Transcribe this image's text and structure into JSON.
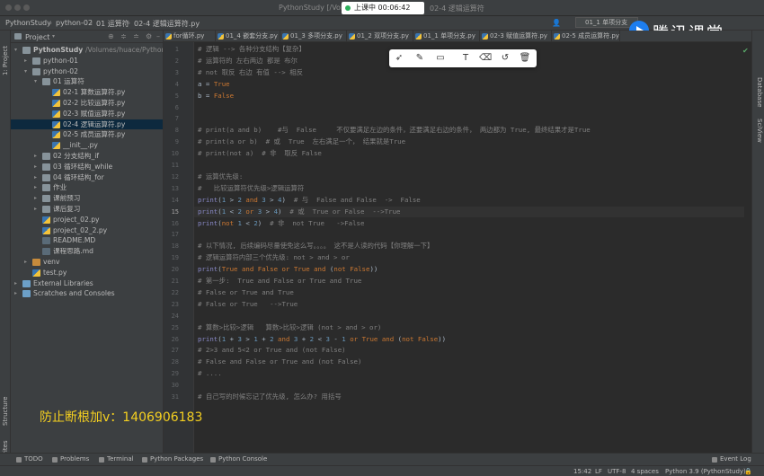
{
  "window": {
    "title_left": "PythonStudy [/Volu",
    "title_right": "02-4 逻辑运算符"
  },
  "recording": {
    "label": "上课中 00:06:42"
  },
  "breadcrumb": [
    "PythonStudy",
    "python-02",
    "01 运算符",
    "02-4 逻辑运算符.py"
  ],
  "run_config": "01_1 单项分支",
  "logo_text": "腾讯课堂",
  "project_panel": {
    "title": "Project",
    "tree": [
      {
        "label": "PythonStudy",
        "path": "/Volumes/huace/PythonS",
        "indent": 0,
        "icon": "folder",
        "arrow": "▾",
        "bold": true
      },
      {
        "label": "python-01",
        "indent": 1,
        "icon": "folder",
        "arrow": "▸"
      },
      {
        "label": "python-02",
        "indent": 1,
        "icon": "folder",
        "arrow": "▾"
      },
      {
        "label": "01 运算符",
        "indent": 2,
        "icon": "folder",
        "arrow": "▾"
      },
      {
        "label": "02-1 算数运算符.py",
        "indent": 3,
        "icon": "py"
      },
      {
        "label": "02-2 比较运算符.py",
        "indent": 3,
        "icon": "py"
      },
      {
        "label": "02-3 赋值运算符.py",
        "indent": 3,
        "icon": "py"
      },
      {
        "label": "02-4 逻辑运算符.py",
        "indent": 3,
        "icon": "py",
        "selected": true
      },
      {
        "label": "02-5 成员运算符.py",
        "indent": 3,
        "icon": "py"
      },
      {
        "label": "__init__.py",
        "indent": 3,
        "icon": "py"
      },
      {
        "label": "02 分支结构_if",
        "indent": 2,
        "icon": "folder",
        "arrow": "▸"
      },
      {
        "label": "03 循环结构_while",
        "indent": 2,
        "icon": "folder",
        "arrow": "▸"
      },
      {
        "label": "04 循环结构_for",
        "indent": 2,
        "icon": "folder",
        "arrow": "▸"
      },
      {
        "label": "作业",
        "indent": 2,
        "icon": "folder",
        "arrow": "▸"
      },
      {
        "label": "课前预习",
        "indent": 2,
        "icon": "folder",
        "arrow": "▸"
      },
      {
        "label": "课后复习",
        "indent": 2,
        "icon": "folder",
        "arrow": "▸"
      },
      {
        "label": "project_02.py",
        "indent": 2,
        "icon": "py"
      },
      {
        "label": "project_02_2.py",
        "indent": 2,
        "icon": "py"
      },
      {
        "label": "README.MD",
        "indent": 2,
        "icon": "md"
      },
      {
        "label": "课程思路.md",
        "indent": 2,
        "icon": "md"
      },
      {
        "label": "venv",
        "indent": 1,
        "icon": "folder-orange",
        "arrow": "▸"
      },
      {
        "label": "test.py",
        "indent": 1,
        "icon": "py"
      },
      {
        "label": "External Libraries",
        "indent": 0,
        "icon": "folder-blue",
        "arrow": "▸"
      },
      {
        "label": "Scratches and Consoles",
        "indent": 0,
        "icon": "folder-blue",
        "arrow": "▸"
      }
    ]
  },
  "editor_tabs": [
    {
      "label": "for循环.py"
    },
    {
      "label": "01_4 嵌套分支.py"
    },
    {
      "label": "01_3 多项分支.py"
    },
    {
      "label": "01_2 双项分支.py"
    },
    {
      "label": "01_1 单项分支.py"
    },
    {
      "label": "02-3 赋值运算符.py"
    },
    {
      "label": "02-5 成员运算符.py"
    }
  ],
  "editor": {
    "current_line": 15,
    "lines": [
      [
        [
          "c-com",
          "# 逻辑 --> 各种分支结构【复杂】"
        ]
      ],
      [
        [
          "c-com",
          "# 运算符的 左右两边 都是 布尔"
        ]
      ],
      [
        [
          "c-com",
          "# not 取反 右边 有值 --> 相反"
        ]
      ],
      [
        [
          "c-def",
          "a = "
        ],
        [
          "c-kw",
          "True"
        ]
      ],
      [
        [
          "c-def",
          "b = "
        ],
        [
          "c-kw",
          "False"
        ]
      ],
      [],
      [],
      [
        [
          "c-com",
          "# print(a and b)    #与  False     不仅要满足左边的条件，还要满足右边的条件， 两边都为 True, 最终结果才是True"
        ]
      ],
      [
        [
          "c-com",
          "# print(a or b)  # 或  True  左右满足一个， 结果就是True"
        ]
      ],
      [
        [
          "c-com",
          "# print(not a)  # 非  取反 False"
        ]
      ],
      [],
      [
        [
          "c-com",
          "# 运算优先级:"
        ]
      ],
      [
        [
          "c-com",
          "#   比较运算符优先级>逻辑运算符"
        ]
      ],
      [
        [
          "c-bi",
          "print"
        ],
        [
          "c-def",
          "("
        ],
        [
          "c-num",
          "1"
        ],
        [
          "c-def",
          " > "
        ],
        [
          "c-num",
          "2"
        ],
        [
          "c-def",
          " "
        ],
        [
          "c-kw",
          "and"
        ],
        [
          "c-def",
          " "
        ],
        [
          "c-num",
          "3"
        ],
        [
          "c-def",
          " > "
        ],
        [
          "c-num",
          "4"
        ],
        [
          "c-def",
          ")  "
        ],
        [
          "c-com",
          "# 与  False and False  ->  False"
        ]
      ],
      [
        [
          "c-bi",
          "print"
        ],
        [
          "c-def",
          "("
        ],
        [
          "c-num",
          "1"
        ],
        [
          "c-def",
          " < "
        ],
        [
          "c-num",
          "2"
        ],
        [
          "c-def",
          " "
        ],
        [
          "c-kw",
          "or"
        ],
        [
          "c-def",
          " "
        ],
        [
          "c-num",
          "3"
        ],
        [
          "c-def",
          " > "
        ],
        [
          "c-num",
          "4"
        ],
        [
          "c-def",
          ")  "
        ],
        [
          "c-com",
          "# 或  True or False  -->True"
        ]
      ],
      [
        [
          "c-bi",
          "print"
        ],
        [
          "c-def",
          "("
        ],
        [
          "c-kw",
          "not"
        ],
        [
          "c-def",
          " "
        ],
        [
          "c-num",
          "1"
        ],
        [
          "c-def",
          " < "
        ],
        [
          "c-num",
          "2"
        ],
        [
          "c-def",
          ")  "
        ],
        [
          "c-com",
          "# 非  not True   ->False"
        ]
      ],
      [],
      [
        [
          "c-com",
          "# 以下情况, 后续编码尽量使免这么写。。。。 这不是人读的代码【你理解一下】"
        ]
      ],
      [
        [
          "c-com",
          "# 逻辑运算符内部三个优先级: not > and > or"
        ]
      ],
      [
        [
          "c-bi",
          "print"
        ],
        [
          "c-def",
          "("
        ],
        [
          "c-kw",
          "True"
        ],
        [
          "c-def",
          " "
        ],
        [
          "c-kw",
          "and"
        ],
        [
          "c-def",
          " "
        ],
        [
          "c-kw",
          "False"
        ],
        [
          "c-def",
          " "
        ],
        [
          "c-kw",
          "or"
        ],
        [
          "c-def",
          " "
        ],
        [
          "c-kw",
          "True"
        ],
        [
          "c-def",
          " "
        ],
        [
          "c-kw",
          "and"
        ],
        [
          "c-def",
          " ("
        ],
        [
          "c-kw",
          "not"
        ],
        [
          "c-def",
          " "
        ],
        [
          "c-kw",
          "False"
        ],
        [
          "c-def",
          "))"
        ]
      ],
      [
        [
          "c-com",
          "# 第一步:  True and False or True and True"
        ]
      ],
      [
        [
          "c-com",
          "# False or True and True"
        ]
      ],
      [
        [
          "c-com",
          "# False or True   -->True"
        ]
      ],
      [],
      [
        [
          "c-com",
          "# 算数>比较>逻辑   算数>比较>逻辑 (not > and > or)"
        ]
      ],
      [
        [
          "c-bi",
          "print"
        ],
        [
          "c-def",
          "("
        ],
        [
          "c-num",
          "1"
        ],
        [
          "c-def",
          " + "
        ],
        [
          "c-num",
          "3"
        ],
        [
          "c-def",
          " > "
        ],
        [
          "c-num",
          "1"
        ],
        [
          "c-def",
          " + "
        ],
        [
          "c-num",
          "2"
        ],
        [
          "c-def",
          " "
        ],
        [
          "c-kw",
          "and"
        ],
        [
          "c-def",
          " "
        ],
        [
          "c-num",
          "3"
        ],
        [
          "c-def",
          " + "
        ],
        [
          "c-num",
          "2"
        ],
        [
          "c-def",
          " < "
        ],
        [
          "c-num",
          "3"
        ],
        [
          "c-def",
          " - "
        ],
        [
          "c-num",
          "1"
        ],
        [
          "c-def",
          " "
        ],
        [
          "c-kw",
          "or"
        ],
        [
          "c-def",
          " "
        ],
        [
          "c-kw",
          "True"
        ],
        [
          "c-def",
          " "
        ],
        [
          "c-kw",
          "and"
        ],
        [
          "c-def",
          " ("
        ],
        [
          "c-kw",
          "not"
        ],
        [
          "c-def",
          " "
        ],
        [
          "c-kw",
          "False"
        ],
        [
          "c-def",
          "))"
        ]
      ],
      [
        [
          "c-com",
          "# 2>3 and 5<2 or True and (not False)"
        ]
      ],
      [
        [
          "c-com",
          "# False and False or True and (not False)"
        ]
      ],
      [
        [
          "c-com",
          "# ...."
        ]
      ],
      [],
      [
        [
          "c-com",
          "# 自己写的时候忘记了优先级, 怎么办? 用括号"
        ]
      ]
    ]
  },
  "antitheft_text": "防止断根加v：1406906183",
  "left_stripe": {
    "project": "1: Project",
    "structure": "Structure",
    "favorites": "Favorites"
  },
  "right_stripe": {
    "database": "Database",
    "sciview": "SciView"
  },
  "bottom_tools": [
    "TODO",
    "Problems",
    "Terminal",
    "Python Packages",
    "Python Console",
    "Event Log"
  ],
  "status": {
    "position": "15:42",
    "line_sep": "LF",
    "encoding": "UTF-8",
    "indent": "4 spaces",
    "interpreter": "Python 3.9 (PythonStudy)"
  },
  "annotation_toolbar": [
    "select-icon",
    "pen-icon",
    "rectangle-icon",
    "text-icon",
    "eraser-icon",
    "undo-icon",
    "delete-icon"
  ]
}
